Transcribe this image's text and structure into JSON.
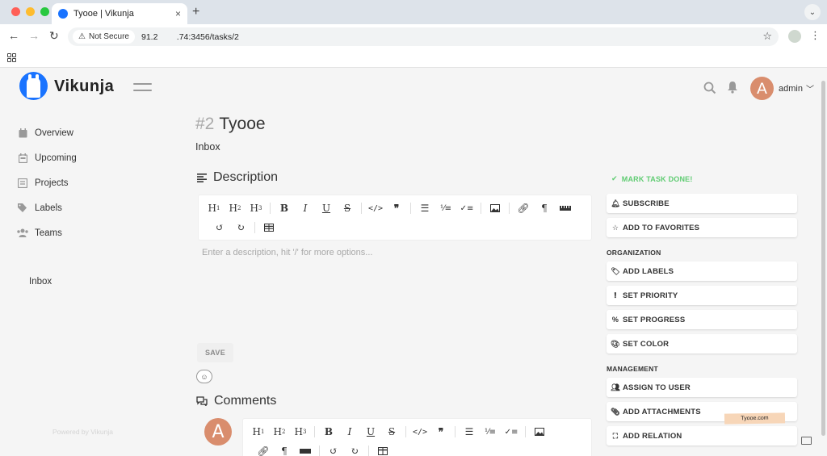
{
  "browser": {
    "tab_title": "Tyooe | Vikunja",
    "new_tab": "+",
    "tab_close": "×",
    "security_chip": "Not Secure",
    "url": "91.2    .74:3456/tasks/2",
    "dot_colors": [
      "#ff5f57",
      "#febc2e",
      "#28c840"
    ]
  },
  "app": {
    "logo_text": "Vikunja",
    "user": "admin",
    "avatar_letter": "A",
    "nav": [
      {
        "label": "Overview",
        "icon": "calendar-icon"
      },
      {
        "label": "Upcoming",
        "icon": "calendar-week-icon"
      },
      {
        "label": "Projects",
        "icon": "layer-group-icon"
      },
      {
        "label": "Labels",
        "icon": "tags-icon"
      },
      {
        "label": "Teams",
        "icon": "users-icon"
      }
    ],
    "inbox_link": "Inbox",
    "powered_by": "Powered by Vikunja"
  },
  "task": {
    "number": "#2",
    "title": "Tyooe",
    "project": "Inbox",
    "description_heading": "Description",
    "description_placeholder": "Enter a description, hit '/' for more options...",
    "save_label": "SAVE",
    "comments_heading": "Comments"
  },
  "actions": {
    "mark_done": "MARK TASK DONE!",
    "subscribe": "SUBSCRIBE",
    "favorite": "ADD TO FAVORITES",
    "organization_heading": "ORGANIZATION",
    "add_labels": "ADD LABELS",
    "set_priority": "SET PRIORITY",
    "set_progress": "SET PROGRESS",
    "set_color": "SET COLOR",
    "management_heading": "MANAGEMENT",
    "assign": "ASSIGN TO USER",
    "attachments": "ADD ATTACHMENTS",
    "relation": "ADD RELATION"
  },
  "watermark": "Tyooe.com",
  "colors": {
    "brand": "#1973ff",
    "done_green": "#5fcc72",
    "avatar_bg": "#d98d6d"
  }
}
